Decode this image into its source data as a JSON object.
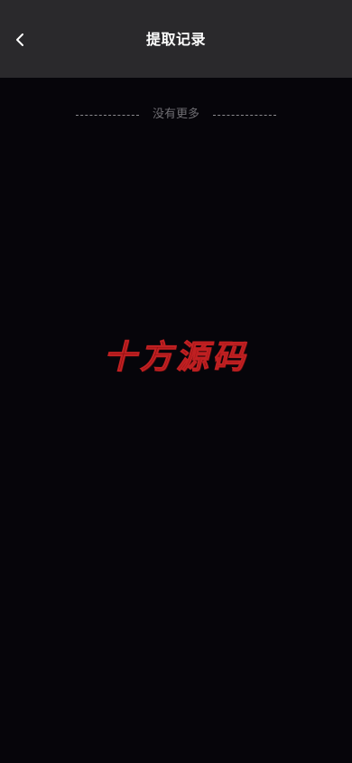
{
  "header": {
    "title": "提取记录",
    "back_icon": "chevron-left-icon"
  },
  "list": {
    "end_text": "没有更多"
  },
  "watermark": {
    "text": "十方源码",
    "color": "#8c0f10"
  },
  "colors": {
    "background": "#06050a",
    "header_background": "#2a292c",
    "title": "#ffffff",
    "muted_text": "#6e6d72"
  }
}
